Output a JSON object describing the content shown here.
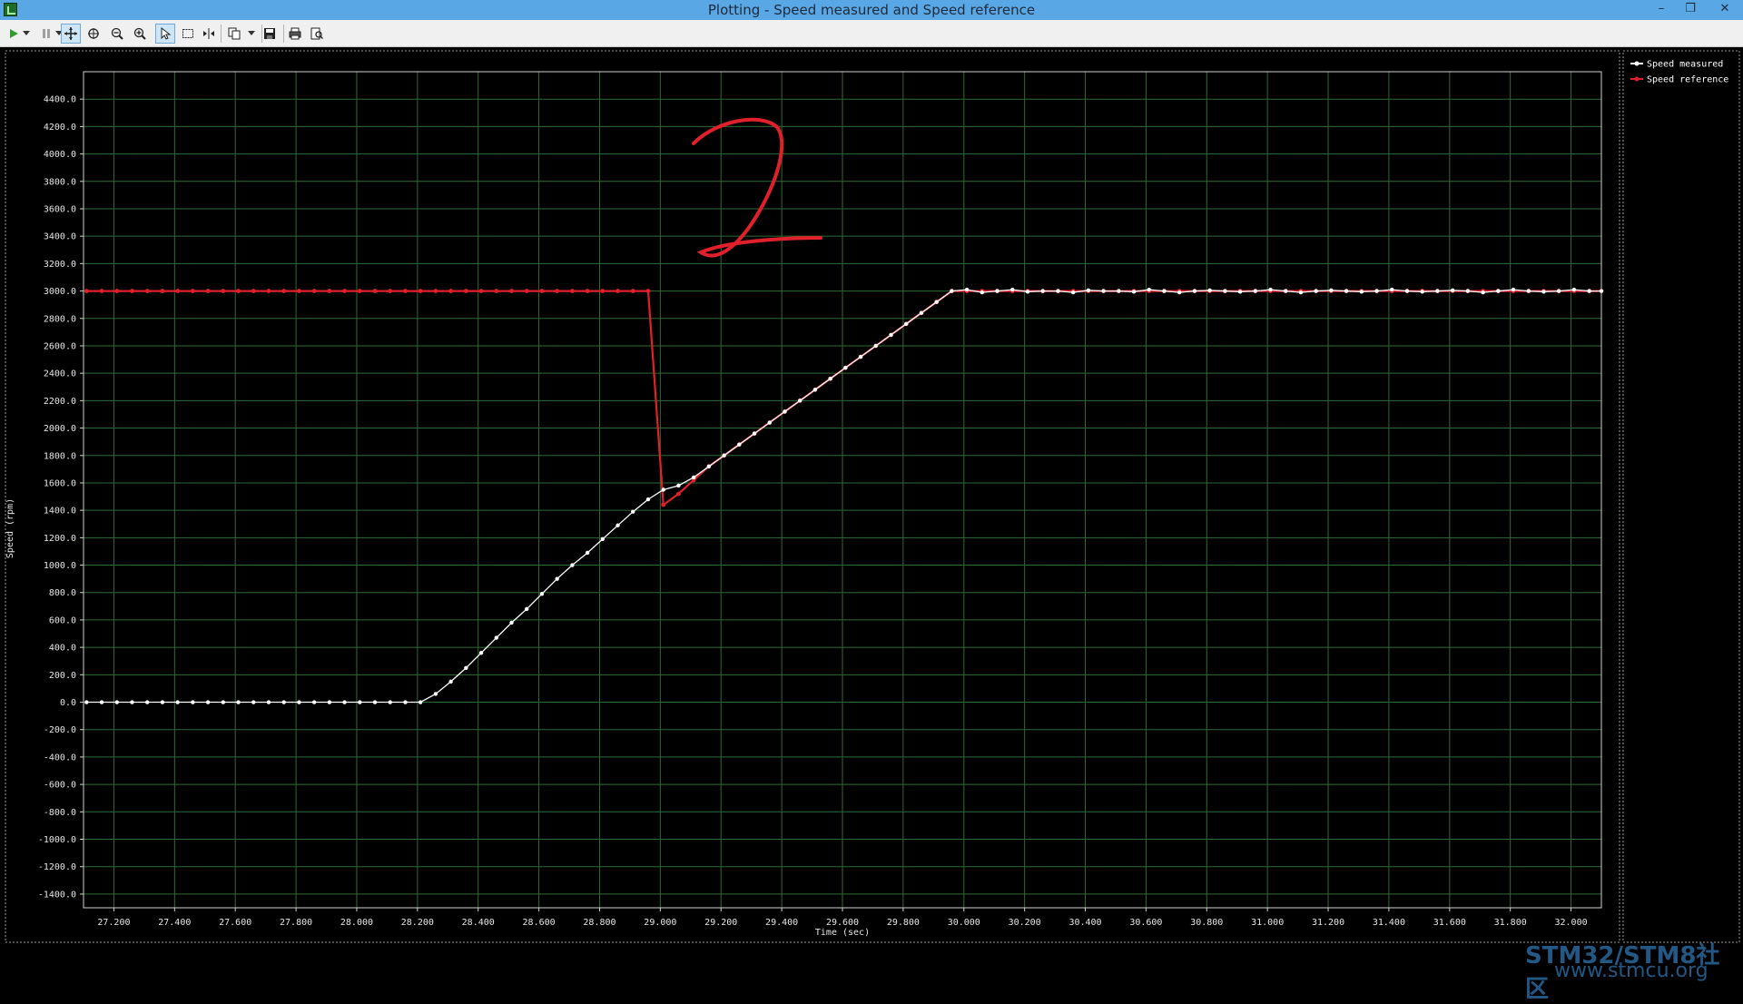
{
  "window": {
    "title": "Plotting  - Speed measured and Speed reference",
    "minimize": "–",
    "restore": "❐",
    "close": "✕"
  },
  "toolbar": {
    "buttons": [
      "play-icon",
      "dropdown-icon",
      "pause-icon",
      "dropdown-icon",
      "pan-icon",
      "zoom-area-icon",
      "zoom-out-icon",
      "zoom-in-icon",
      "select-icon",
      "rect-select-icon",
      "fit-icon",
      "copy-icon",
      "dropdown-icon",
      "save-icon",
      "print-icon",
      "print-preview-icon"
    ]
  },
  "watermark": {
    "line1": "STM32/STM8社区",
    "line2": "www.stmcu.org"
  },
  "chart_data": {
    "type": "line",
    "xlabel": "Time (sec)",
    "ylabel": "Speed (rpm)",
    "xlim": [
      27.1,
      32.1
    ],
    "ylim": [
      -1500,
      4600
    ],
    "xticks": [
      "27.200",
      "27.400",
      "27.600",
      "27.800",
      "28.000",
      "28.200",
      "28.400",
      "28.600",
      "28.800",
      "29.000",
      "29.200",
      "29.400",
      "29.600",
      "29.800",
      "30.000",
      "30.200",
      "30.400",
      "30.600",
      "30.800",
      "31.000",
      "31.200",
      "31.400",
      "31.600",
      "31.800",
      "32.000"
    ],
    "yticks": [
      "4400.0",
      "4200.0",
      "4000.0",
      "3800.0",
      "3600.0",
      "3400.0",
      "3200.0",
      "3000.0",
      "2800.0",
      "2600.0",
      "2400.0",
      "2200.0",
      "2000.0",
      "1800.0",
      "1600.0",
      "1400.0",
      "1200.0",
      "1000.0",
      "800.0",
      "600.0",
      "400.0",
      "200.0",
      "0.0",
      "-200.0",
      "-400.0",
      "-600.0",
      "-800.0",
      "-1000.0",
      "-1200.0",
      "-1400.0"
    ],
    "grid": true,
    "legend_position": "top-right",
    "series": [
      {
        "name": "Speed measured",
        "color": "#ffffff",
        "points": [
          [
            27.11,
            0
          ],
          [
            27.16,
            0
          ],
          [
            27.21,
            0
          ],
          [
            27.26,
            0
          ],
          [
            27.31,
            0
          ],
          [
            27.36,
            0
          ],
          [
            27.41,
            0
          ],
          [
            27.46,
            0
          ],
          [
            27.51,
            0
          ],
          [
            27.56,
            0
          ],
          [
            27.61,
            0
          ],
          [
            27.66,
            0
          ],
          [
            27.71,
            0
          ],
          [
            27.76,
            0
          ],
          [
            27.81,
            0
          ],
          [
            27.86,
            0
          ],
          [
            27.91,
            0
          ],
          [
            27.96,
            0
          ],
          [
            28.01,
            0
          ],
          [
            28.06,
            0
          ],
          [
            28.11,
            0
          ],
          [
            28.16,
            0
          ],
          [
            28.21,
            0
          ],
          [
            28.26,
            60
          ],
          [
            28.31,
            150
          ],
          [
            28.36,
            250
          ],
          [
            28.41,
            360
          ],
          [
            28.46,
            470
          ],
          [
            28.51,
            580
          ],
          [
            28.56,
            680
          ],
          [
            28.61,
            790
          ],
          [
            28.66,
            900
          ],
          [
            28.71,
            1000
          ],
          [
            28.76,
            1090
          ],
          [
            28.81,
            1190
          ],
          [
            28.86,
            1290
          ],
          [
            28.91,
            1390
          ],
          [
            28.96,
            1480
          ],
          [
            29.01,
            1550
          ],
          [
            29.06,
            1580
          ],
          [
            29.11,
            1640
          ],
          [
            29.16,
            1720
          ],
          [
            29.21,
            1800
          ],
          [
            29.26,
            1880
          ],
          [
            29.31,
            1960
          ],
          [
            29.36,
            2040
          ],
          [
            29.41,
            2120
          ],
          [
            29.46,
            2200
          ],
          [
            29.51,
            2280
          ],
          [
            29.56,
            2360
          ],
          [
            29.61,
            2440
          ],
          [
            29.66,
            2520
          ],
          [
            29.71,
            2600
          ],
          [
            29.76,
            2680
          ],
          [
            29.81,
            2760
          ],
          [
            29.86,
            2840
          ],
          [
            29.91,
            2920
          ],
          [
            29.96,
            3000
          ],
          [
            30.01,
            3010
          ],
          [
            30.06,
            2990
          ],
          [
            30.11,
            3000
          ],
          [
            30.16,
            3010
          ],
          [
            30.21,
            2995
          ],
          [
            30.26,
            3000
          ],
          [
            30.31,
            3000
          ],
          [
            30.36,
            2990
          ],
          [
            30.41,
            3005
          ],
          [
            30.46,
            3000
          ],
          [
            30.51,
            3000
          ],
          [
            30.56,
            2995
          ],
          [
            30.61,
            3010
          ],
          [
            30.66,
            3000
          ],
          [
            30.71,
            2990
          ],
          [
            30.76,
            3000
          ],
          [
            30.81,
            3005
          ],
          [
            30.86,
            3000
          ],
          [
            30.91,
            2995
          ],
          [
            30.96,
            3000
          ],
          [
            31.01,
            3010
          ],
          [
            31.06,
            3000
          ],
          [
            31.11,
            2990
          ],
          [
            31.16,
            3000
          ],
          [
            31.21,
            3005
          ],
          [
            31.26,
            3000
          ],
          [
            31.31,
            2995
          ],
          [
            31.36,
            3000
          ],
          [
            31.41,
            3010
          ],
          [
            31.46,
            3000
          ],
          [
            31.51,
            2995
          ],
          [
            31.56,
            3000
          ],
          [
            31.61,
            3005
          ],
          [
            31.66,
            3000
          ],
          [
            31.71,
            2990
          ],
          [
            31.76,
            3000
          ],
          [
            31.81,
            3010
          ],
          [
            31.86,
            3000
          ],
          [
            31.91,
            2995
          ],
          [
            31.96,
            3000
          ],
          [
            32.01,
            3010
          ],
          [
            32.06,
            3000
          ],
          [
            32.1,
            3000
          ]
        ]
      },
      {
        "name": "Speed reference",
        "color": "#e0202a",
        "points": [
          [
            27.11,
            3000
          ],
          [
            27.16,
            3000
          ],
          [
            27.21,
            3000
          ],
          [
            27.26,
            3000
          ],
          [
            27.31,
            3000
          ],
          [
            27.36,
            3000
          ],
          [
            27.41,
            3000
          ],
          [
            27.46,
            3000
          ],
          [
            27.51,
            3000
          ],
          [
            27.56,
            3000
          ],
          [
            27.61,
            3000
          ],
          [
            27.66,
            3000
          ],
          [
            27.71,
            3000
          ],
          [
            27.76,
            3000
          ],
          [
            27.81,
            3000
          ],
          [
            27.86,
            3000
          ],
          [
            27.91,
            3000
          ],
          [
            27.96,
            3000
          ],
          [
            28.01,
            3000
          ],
          [
            28.06,
            3000
          ],
          [
            28.11,
            3000
          ],
          [
            28.16,
            3000
          ],
          [
            28.21,
            3000
          ],
          [
            28.26,
            3000
          ],
          [
            28.31,
            3000
          ],
          [
            28.36,
            3000
          ],
          [
            28.41,
            3000
          ],
          [
            28.46,
            3000
          ],
          [
            28.51,
            3000
          ],
          [
            28.56,
            3000
          ],
          [
            28.61,
            3000
          ],
          [
            28.66,
            3000
          ],
          [
            28.71,
            3000
          ],
          [
            28.76,
            3000
          ],
          [
            28.81,
            3000
          ],
          [
            28.86,
            3000
          ],
          [
            28.91,
            3000
          ],
          [
            28.96,
            3000
          ],
          [
            29.01,
            1440
          ],
          [
            29.06,
            1520
          ],
          [
            29.11,
            1620
          ],
          [
            29.16,
            1720
          ],
          [
            29.21,
            1800
          ],
          [
            29.26,
            1880
          ],
          [
            29.31,
            1960
          ],
          [
            29.36,
            2040
          ],
          [
            29.41,
            2120
          ],
          [
            29.46,
            2200
          ],
          [
            29.51,
            2280
          ],
          [
            29.56,
            2360
          ],
          [
            29.61,
            2440
          ],
          [
            29.66,
            2520
          ],
          [
            29.71,
            2600
          ],
          [
            29.76,
            2680
          ],
          [
            29.81,
            2760
          ],
          [
            29.86,
            2840
          ],
          [
            29.91,
            2920
          ],
          [
            29.96,
            3000
          ],
          [
            30.01,
            3000
          ],
          [
            30.06,
            3000
          ],
          [
            30.11,
            3000
          ],
          [
            30.16,
            3000
          ],
          [
            30.21,
            3000
          ],
          [
            30.26,
            3000
          ],
          [
            30.31,
            3000
          ],
          [
            30.36,
            3000
          ],
          [
            30.41,
            3000
          ],
          [
            30.46,
            3000
          ],
          [
            30.51,
            3000
          ],
          [
            30.56,
            3000
          ],
          [
            30.61,
            3000
          ],
          [
            30.66,
            3000
          ],
          [
            30.71,
            3000
          ],
          [
            30.76,
            3000
          ],
          [
            30.81,
            3000
          ],
          [
            30.86,
            3000
          ],
          [
            30.91,
            3000
          ],
          [
            30.96,
            3000
          ],
          [
            31.01,
            3000
          ],
          [
            31.06,
            3000
          ],
          [
            31.11,
            3000
          ],
          [
            31.16,
            3000
          ],
          [
            31.21,
            3000
          ],
          [
            31.26,
            3000
          ],
          [
            31.31,
            3000
          ],
          [
            31.36,
            3000
          ],
          [
            31.41,
            3000
          ],
          [
            31.46,
            3000
          ],
          [
            31.51,
            3000
          ],
          [
            31.56,
            3000
          ],
          [
            31.61,
            3000
          ],
          [
            31.66,
            3000
          ],
          [
            31.71,
            3000
          ],
          [
            31.76,
            3000
          ],
          [
            31.81,
            3000
          ],
          [
            31.86,
            3000
          ],
          [
            31.91,
            3000
          ],
          [
            31.96,
            3000
          ],
          [
            32.01,
            3000
          ],
          [
            32.06,
            3000
          ],
          [
            32.1,
            3000
          ]
        ]
      }
    ],
    "annotation": {
      "text": "2",
      "color": "#e0202a"
    }
  }
}
